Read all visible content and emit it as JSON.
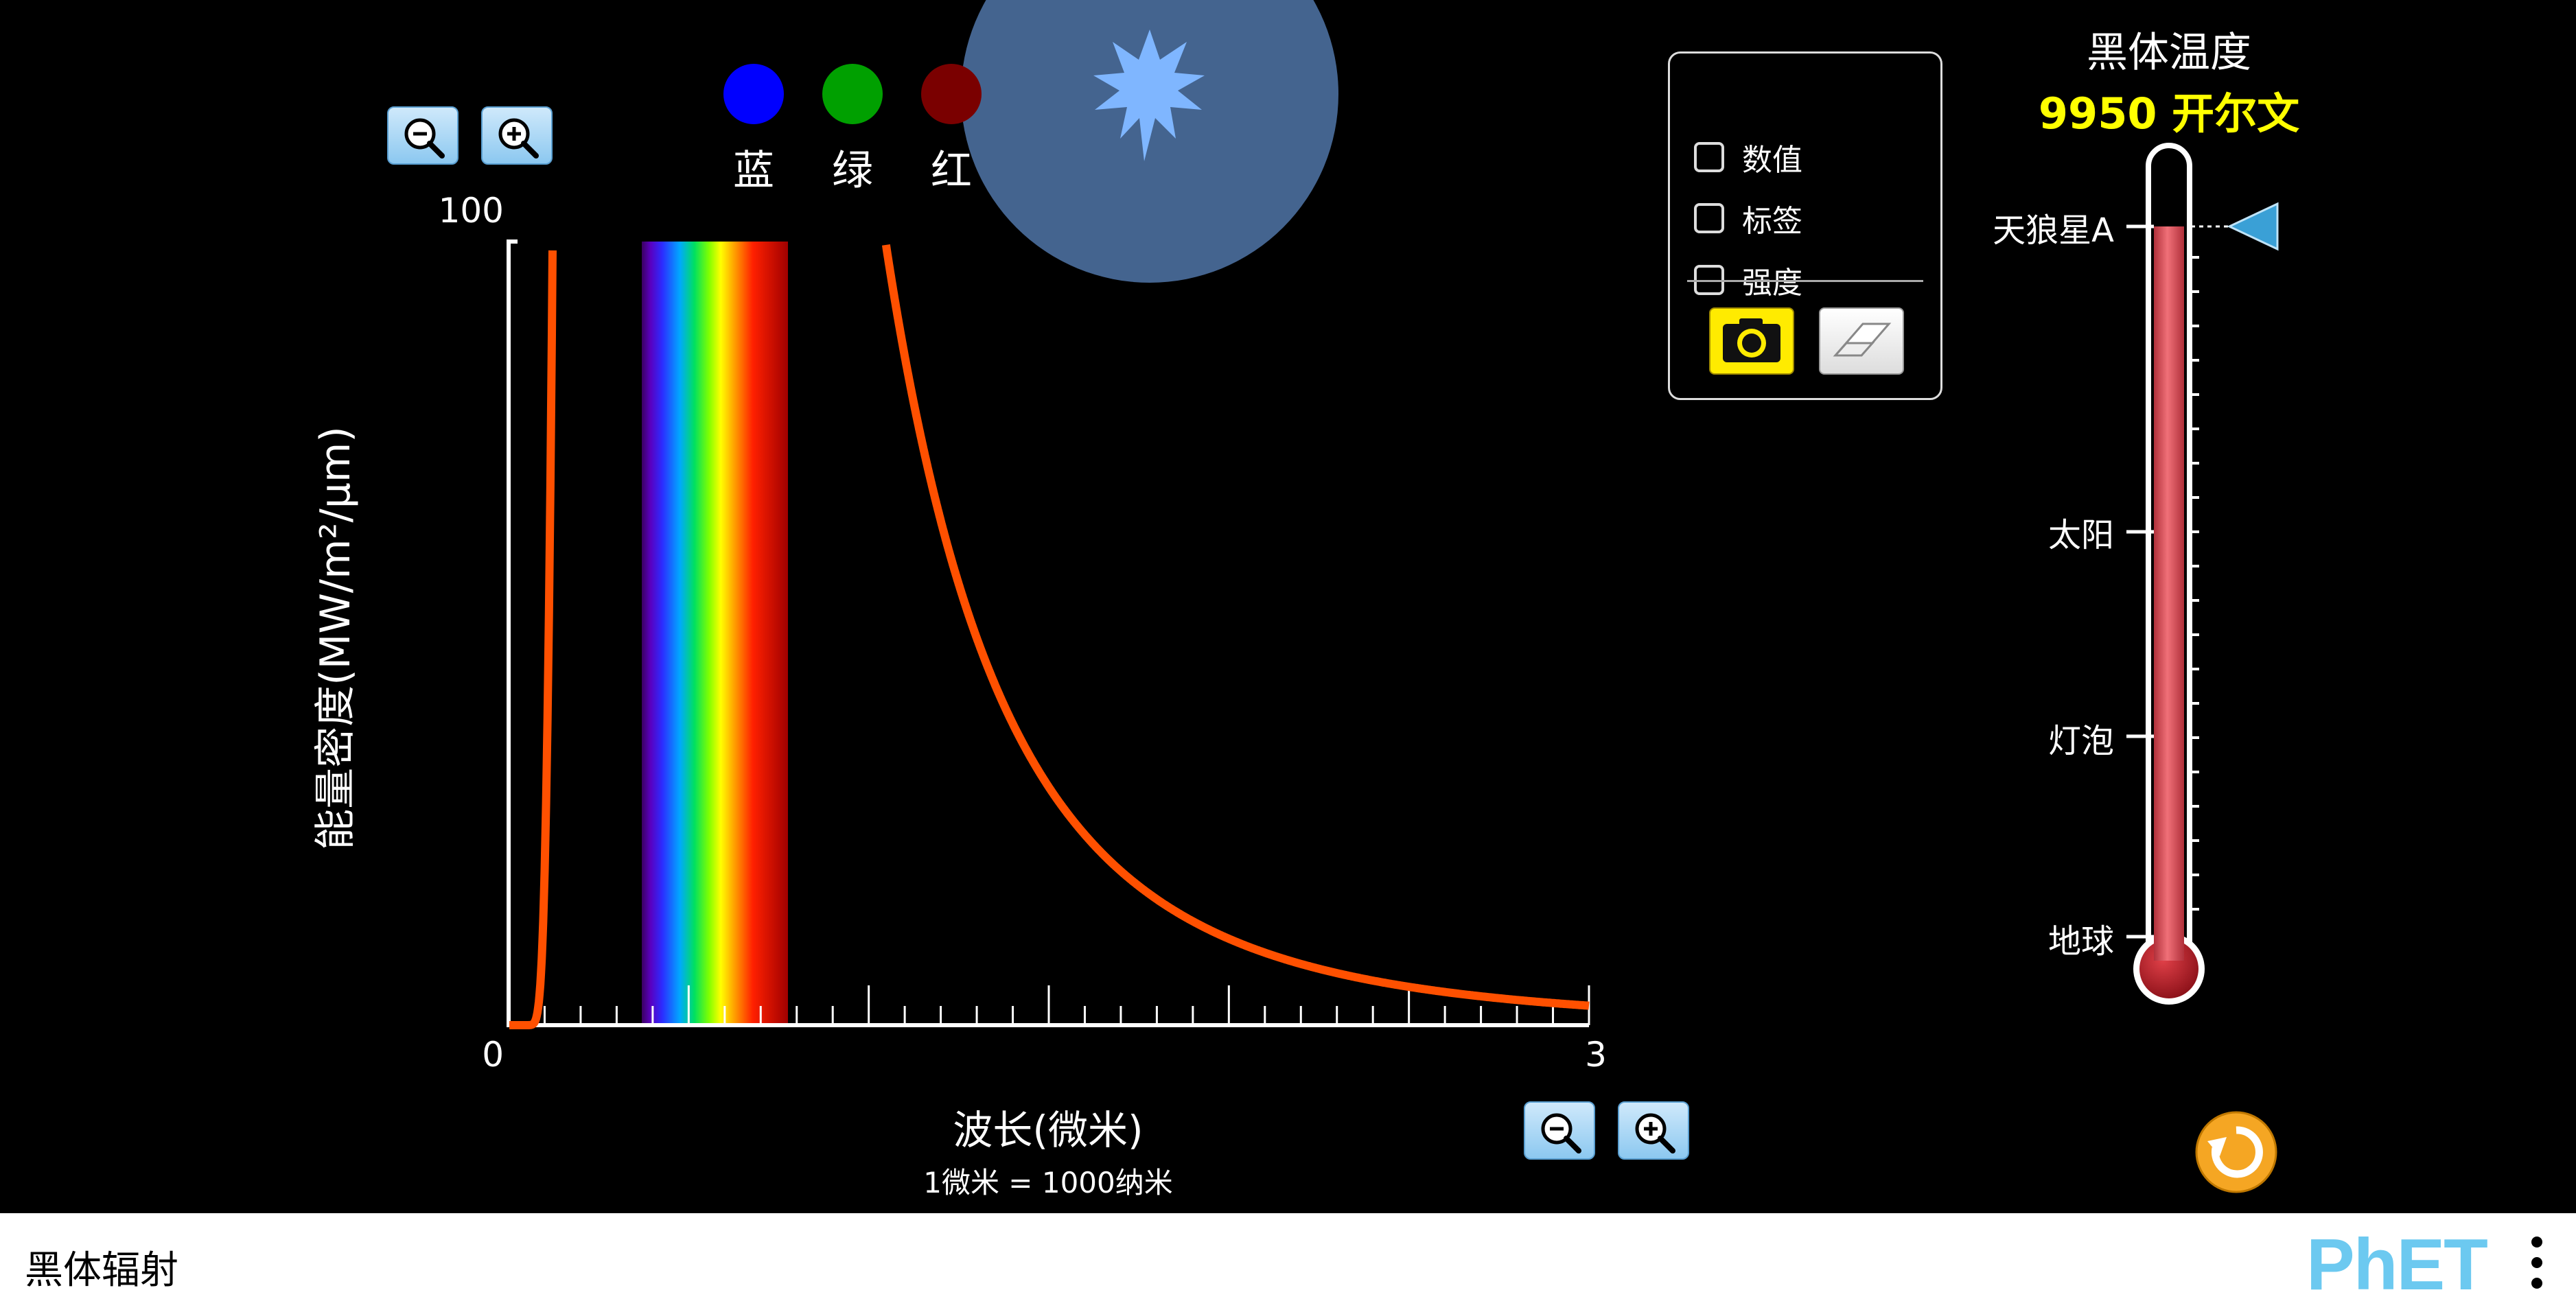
{
  "graph": {
    "y_axis_label": "能量密度(MW/m²/μm)",
    "y_tick_max": "100",
    "y_tick_min": "0",
    "x_tick_max": "3",
    "x_axis_label": "波长(微米)",
    "x_axis_sublabel": "1微米 = 1000纳米"
  },
  "color_indicators": {
    "blue_label": "蓝",
    "green_label": "绿",
    "red_label": "红",
    "blue_color": "#0000ff",
    "green_color": "#00a000",
    "red_color": "#7a0000"
  },
  "control_panel": {
    "values_label": "数值",
    "labels_label": "标签",
    "intensity_label": "强度",
    "values_checked": false,
    "labels_checked": false,
    "intensity_checked": false
  },
  "thermometer": {
    "title": "黑体温度",
    "temperature_readout": "9950 开尔文",
    "markers": {
      "sirius": "天狼星A",
      "sun": "太阳",
      "lightbulb": "灯泡",
      "earth": "地球"
    },
    "fill_color": "#e0505a"
  },
  "nav_bar": {
    "sim_title": "黑体辐射",
    "brand": "PhET"
  },
  "colors": {
    "curve": "#ff5000",
    "star_glow": "#44648f",
    "star": "#7fb6ff",
    "temperature_text": "#ffff00",
    "reset": "#f5a623"
  }
}
